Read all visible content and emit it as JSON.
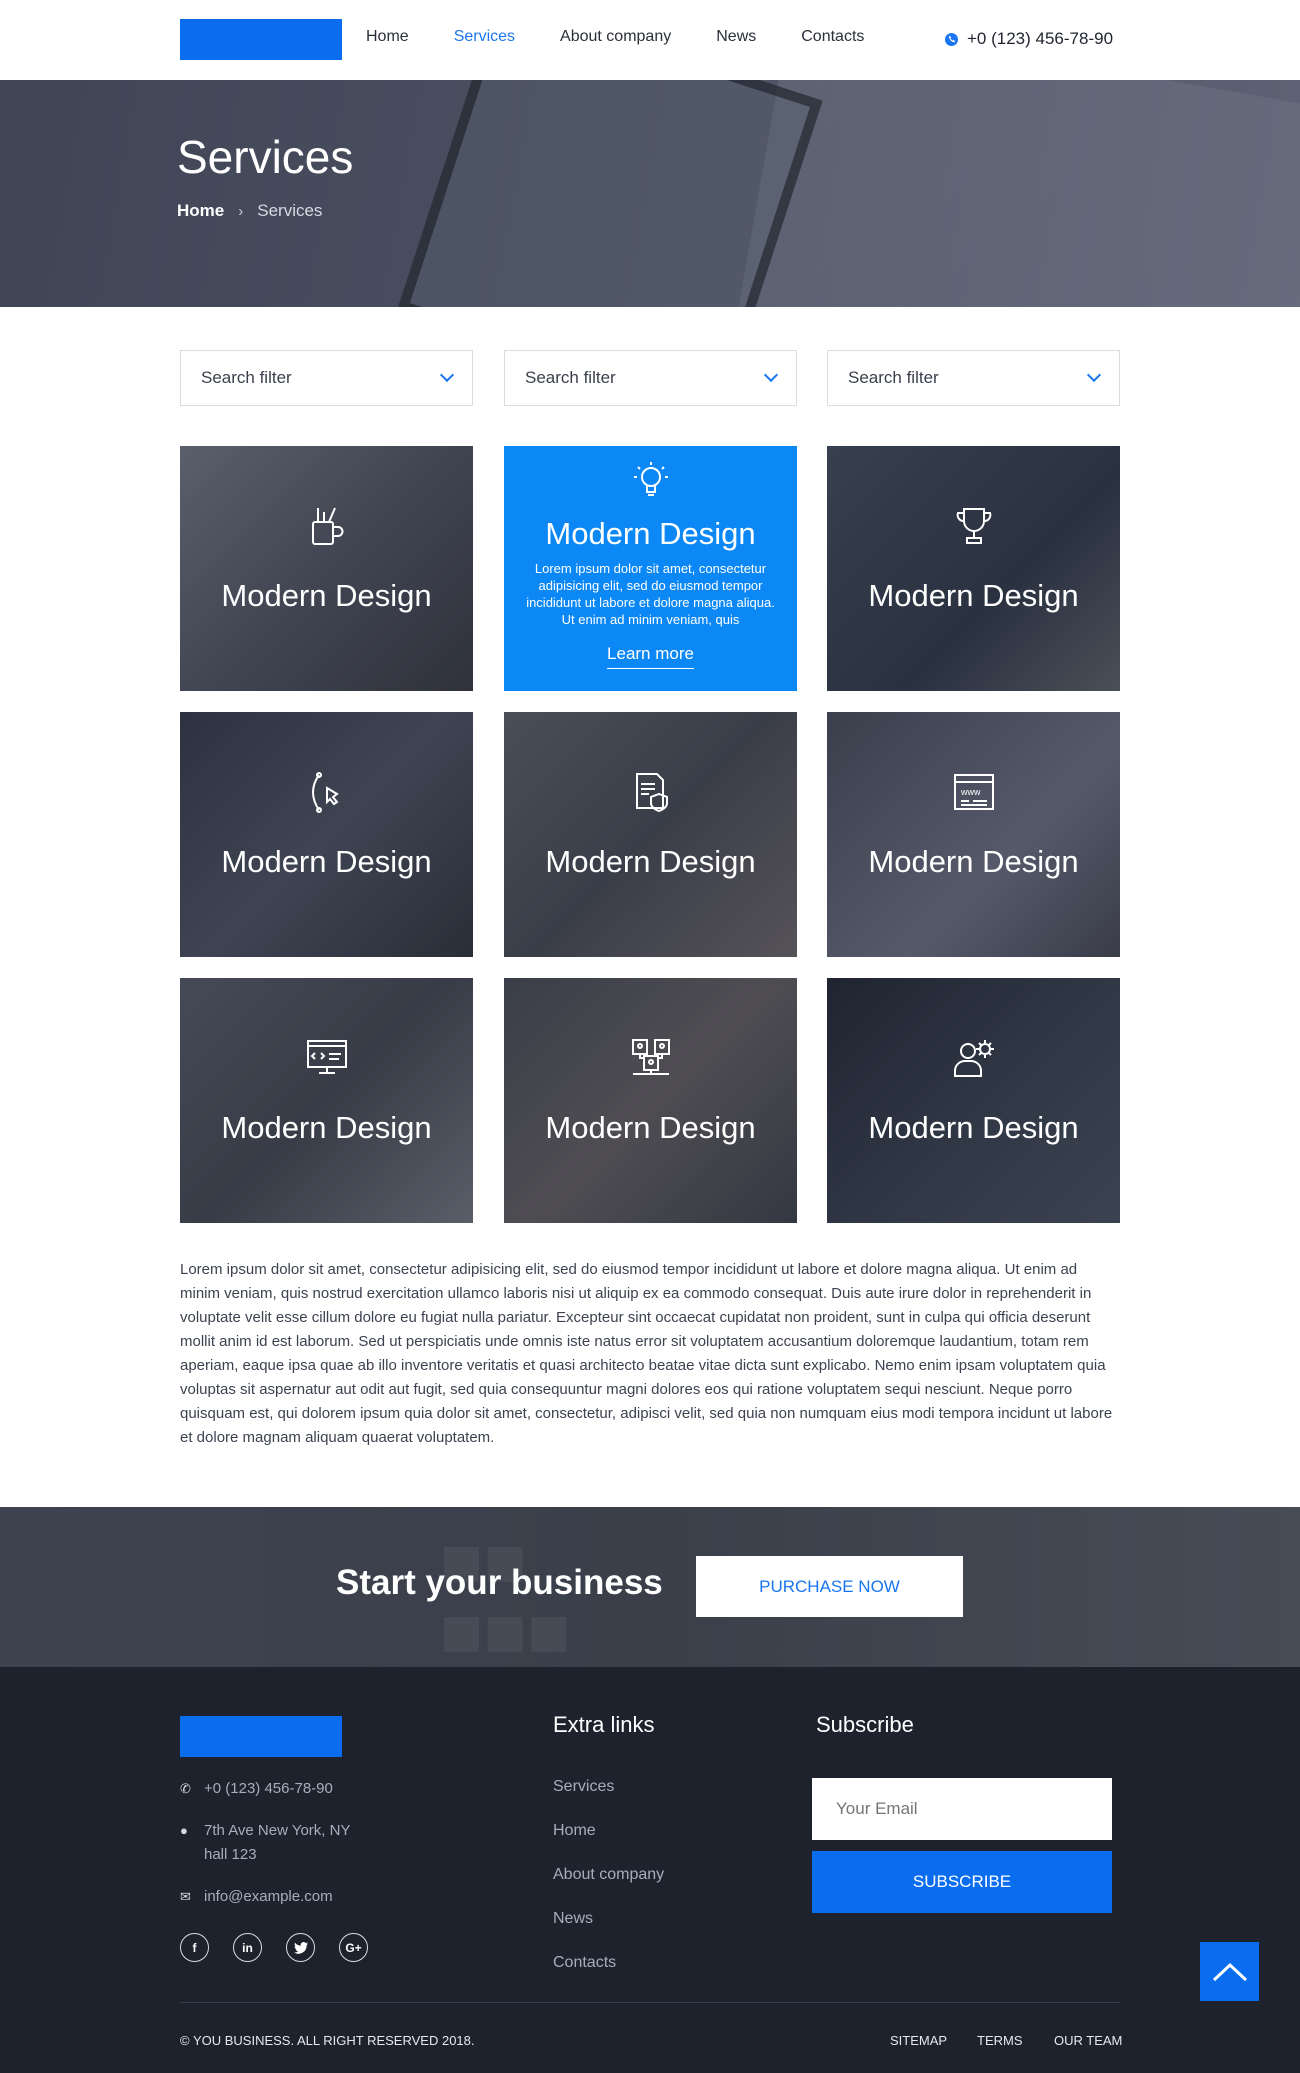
{
  "header": {
    "nav": [
      "Home",
      "Services",
      "About company",
      "News",
      "Contacts"
    ],
    "active_nav": "Services",
    "phone": "+0 (123) 456-78-90"
  },
  "hero": {
    "title": "Services",
    "breadcrumb": {
      "home": "Home",
      "current": "Services"
    }
  },
  "filters": [
    {
      "placeholder": "Search filter"
    },
    {
      "placeholder": "Search filter"
    },
    {
      "placeholder": "Search filter"
    }
  ],
  "cards": [
    {
      "title": "Modern Design",
      "icon": "pencil-cup-icon"
    },
    {
      "title": "Modern Design",
      "icon": "lightbulb-icon",
      "description": "Lorem ipsum dolor sit amet, consectetur adipisicing elit, sed do eiusmod tempor incididunt ut labore et dolore magna aliqua. Ut enim ad minim veniam, quis",
      "link": "Learn more"
    },
    {
      "title": "Modern Design",
      "icon": "trophy-icon"
    },
    {
      "title": "Modern Design",
      "icon": "pen-tool-icon"
    },
    {
      "title": "Modern Design",
      "icon": "document-shield-icon"
    },
    {
      "title": "Modern Design",
      "icon": "www-browser-icon"
    },
    {
      "title": "Modern Design",
      "icon": "code-monitor-icon"
    },
    {
      "title": "Modern Design",
      "icon": "user-network-icon"
    },
    {
      "title": "Modern Design",
      "icon": "user-gear-icon"
    }
  ],
  "body_text": "Lorem ipsum dolor sit amet, consectetur adipisicing elit, sed do eiusmod tempor incididunt ut labore et dolore magna aliqua. Ut enim ad minim veniam, quis nostrud exercitation ullamco laboris nisi ut aliquip ex ea commodo consequat. Duis aute irure dolor in reprehenderit in voluptate velit esse cillum dolore eu fugiat nulla pariatur. Excepteur sint occaecat cupidatat non proident, sunt in culpa qui officia deserunt mollit anim id est laborum. Sed ut perspiciatis unde omnis iste natus error sit voluptatem accusantium doloremque laudantium, totam rem aperiam, eaque ipsa quae ab illo inventore veritatis et quasi architecto beatae vitae dicta sunt explicabo. Nemo enim ipsam voluptatem quia voluptas sit aspernatur aut odit aut fugit, sed quia consequuntur magni dolores eos qui ratione voluptatem sequi nesciunt. Neque porro quisquam est, qui dolorem ipsum quia dolor sit amet, consectetur, adipisci velit, sed quia non numquam eius modi tempora incidunt ut labore et dolore magnam aliquam quaerat voluptatem.",
  "cta": {
    "title": "Start your business",
    "button": "PURCHASE NOW"
  },
  "footer": {
    "phone": "+0 (123) 456-78-90",
    "address_line1": "7th Ave New York, NY",
    "address_line2": "hall 123",
    "email": "info@example.com",
    "socials": [
      "facebook-icon",
      "linkedin-icon",
      "twitter-icon",
      "google-plus-icon"
    ],
    "extra_links_title": "Extra links",
    "extra_links": [
      "Services",
      "Home",
      "About company",
      "News",
      "Contacts"
    ],
    "subscribe_title": "Subscribe",
    "email_placeholder": "Your Email",
    "subscribe_button": "SUBSCRIBE",
    "copyright": "© YOU BUSINESS. ALL RIGHT RESERVED 2018.",
    "legal_links": [
      "SITEMAP",
      "TERMS",
      "OUR TEAM"
    ]
  },
  "colors": {
    "accent": "#0a6df0",
    "featured_card": "#0b88f5",
    "footer_bg": "#1e222d"
  }
}
